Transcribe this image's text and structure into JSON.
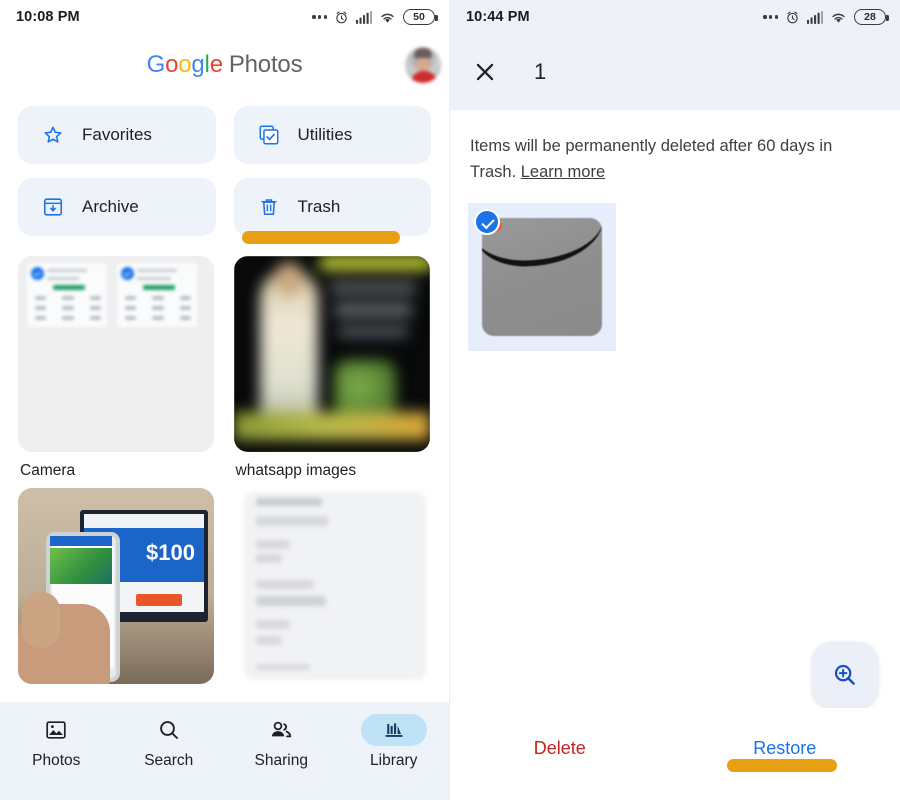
{
  "left_panel": {
    "status_bar": {
      "time": "10:08 PM",
      "battery": "50",
      "icons": [
        "more-dots-icon",
        "alarm-icon",
        "signal-icon",
        "wifi-icon",
        "battery-icon"
      ]
    },
    "header": {
      "logo_letters": [
        "G",
        "o",
        "o",
        "g",
        "l",
        "e"
      ],
      "logo_word": "Photos",
      "avatar_name": "account-avatar"
    },
    "chips": [
      {
        "label": "Favorites",
        "icon": "star-icon"
      },
      {
        "label": "Utilities",
        "icon": "utilities-checkbox-icon"
      },
      {
        "label": "Archive",
        "icon": "archive-box-icon"
      },
      {
        "label": "Trash",
        "icon": "trash-can-icon",
        "highlighted": true
      }
    ],
    "albums": [
      {
        "title": "Camera"
      },
      {
        "title": "whatsapp images"
      }
    ],
    "bottom_nav": [
      {
        "label": "Photos",
        "icon": "photo-icon",
        "active": false
      },
      {
        "label": "Search",
        "icon": "search-icon",
        "active": false
      },
      {
        "label": "Sharing",
        "icon": "people-icon",
        "active": false
      },
      {
        "label": "Library",
        "icon": "library-books-icon",
        "active": true
      }
    ]
  },
  "right_panel": {
    "status_bar": {
      "time": "10:44 PM",
      "battery": "28",
      "icons": [
        "more-dots-icon",
        "alarm-icon",
        "signal-icon",
        "wifi-icon",
        "battery-icon"
      ]
    },
    "selection_toolbar": {
      "close_icon": "close-x-icon",
      "count": "1"
    },
    "notice": {
      "text": "Items will be permanently deleted after 60 days in Trash.",
      "link": "Learn more"
    },
    "trash_items": [
      {
        "selected": true,
        "check_icon": "check-circle-icon"
      }
    ],
    "fab": {
      "icon": "zoom-in-icon"
    },
    "actions": [
      {
        "label": "Delete",
        "color": "#C5221F",
        "highlighted": false
      },
      {
        "label": "Restore",
        "color": "#1A73E8",
        "highlighted": true
      }
    ]
  },
  "annotations": {
    "highlight_color": "#E7A013"
  }
}
